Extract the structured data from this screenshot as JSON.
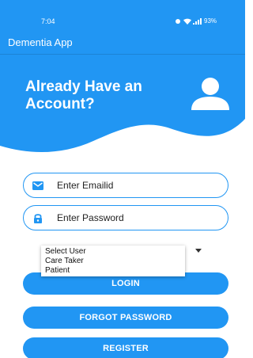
{
  "status_bar": {
    "time": "7:04",
    "battery": "93%"
  },
  "app_bar": {
    "title": "Dementia App"
  },
  "hero": {
    "headline": "Already Have an Account?"
  },
  "form": {
    "email_placeholder": "Enter Emailid",
    "password_placeholder": "Enter Password"
  },
  "user_select": {
    "options": [
      "Select User",
      "Care Taker",
      "Patient"
    ]
  },
  "buttons": {
    "login": "LOGIN",
    "forgot": "FORGOT PASSWORD",
    "register": "REGISTER"
  },
  "colors": {
    "primary": "#2196F3",
    "on_primary": "#ffffff"
  }
}
